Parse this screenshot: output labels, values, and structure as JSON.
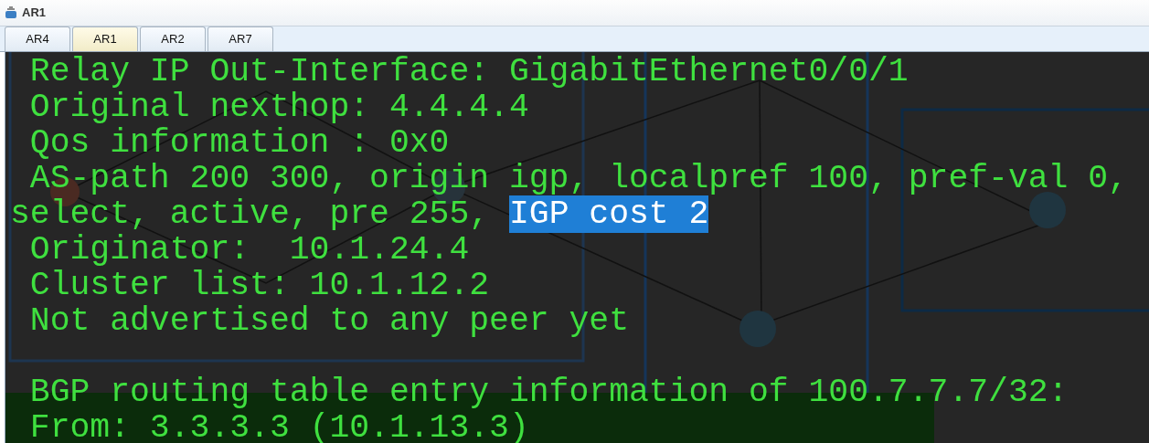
{
  "window": {
    "title": "AR1"
  },
  "tabs": [
    {
      "label": "AR4",
      "selected": false
    },
    {
      "label": "AR1",
      "selected": true
    },
    {
      "label": "AR2",
      "selected": false
    },
    {
      "label": "AR7",
      "selected": false
    }
  ],
  "terminal": {
    "lines": [
      {
        "kind": "text",
        "segments": [
          {
            "text": " Relay IP Out-Interface: GigabitEthernet0/0/1",
            "selected": false
          }
        ]
      },
      {
        "kind": "text",
        "segments": [
          {
            "text": " Original nexthop: 4.4.4.4",
            "selected": false
          }
        ]
      },
      {
        "kind": "text",
        "segments": [
          {
            "text": " Qos information : 0x0",
            "selected": false
          }
        ]
      },
      {
        "kind": "text",
        "segments": [
          {
            "text": " AS-path 200 300, origin igp, localpref 100, pref-val 0,",
            "selected": false
          }
        ]
      },
      {
        "kind": "text",
        "segments": [
          {
            "text": "select, active, pre 255, ",
            "selected": false
          },
          {
            "text": "IGP cost 2",
            "selected": true
          }
        ]
      },
      {
        "kind": "text",
        "segments": [
          {
            "text": " Originator:  10.1.24.4",
            "selected": false
          }
        ]
      },
      {
        "kind": "text",
        "segments": [
          {
            "text": " Cluster list: 10.1.12.2",
            "selected": false
          }
        ]
      },
      {
        "kind": "text",
        "segments": [
          {
            "text": " Not advertised to any peer yet",
            "selected": false
          }
        ]
      },
      {
        "kind": "blank"
      },
      {
        "kind": "text",
        "segments": [
          {
            "text": " BGP routing table entry information of 100.7.7.7/32:",
            "selected": false
          }
        ]
      },
      {
        "kind": "text",
        "segments": [
          {
            "text": " From: 3.3.3.3 (10.1.13.3)",
            "selected": false
          }
        ]
      }
    ]
  }
}
